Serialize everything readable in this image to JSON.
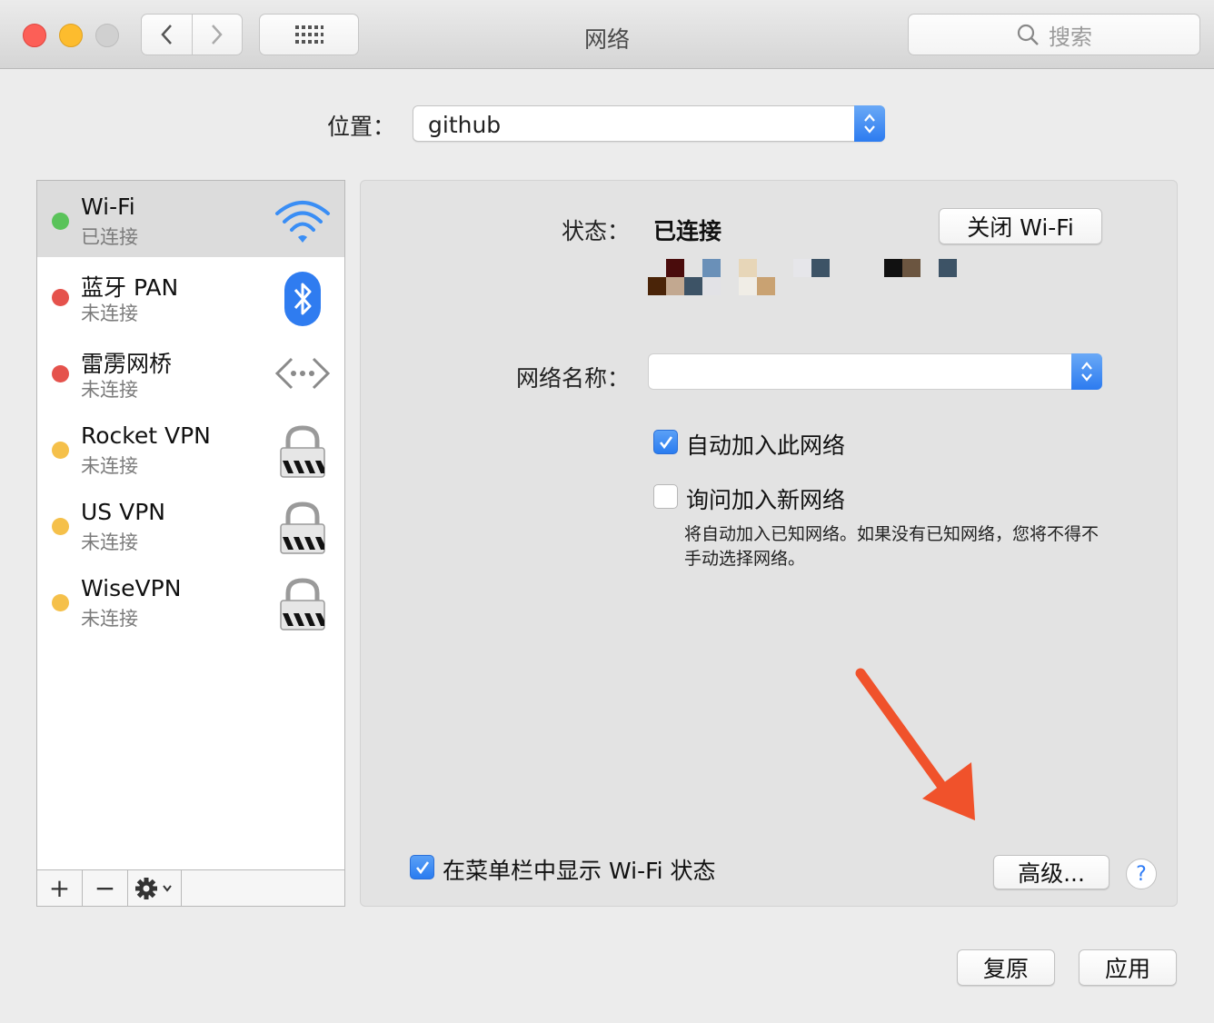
{
  "window": {
    "title": "网络",
    "search_placeholder": "搜索"
  },
  "location": {
    "label": "位置：",
    "value": "github"
  },
  "services": [
    {
      "name": "Wi-Fi",
      "status": "已连接",
      "dot_color": "#5ac35a",
      "icon": "wifi-icon",
      "selected": true
    },
    {
      "name": "蓝牙 PAN",
      "status": "未连接",
      "dot_color": "#e5524c",
      "icon": "bluetooth-icon"
    },
    {
      "name": "雷雳网桥",
      "status": "未连接",
      "dot_color": "#e5524c",
      "icon": "thunderbolt-bridge-icon"
    },
    {
      "name": "Rocket VPN",
      "status": "未连接",
      "dot_color": "#f5c04a",
      "icon": "vpn-lock-icon"
    },
    {
      "name": "US VPN",
      "status": "未连接",
      "dot_color": "#f5c04a",
      "icon": "vpn-lock-icon"
    },
    {
      "name": "WiseVPN",
      "status": "未连接",
      "dot_color": "#f5c04a",
      "icon": "vpn-lock-icon"
    }
  ],
  "sidebar_controls": {
    "add": "+",
    "remove": "−"
  },
  "detail": {
    "status_label": "状态：",
    "status_value": "已连接",
    "turn_off_button": "关闭 Wi-Fi",
    "network_name_label": "网络名称：",
    "network_name_value": "",
    "auto_join_label": "自动加入此网络",
    "auto_join_checked": true,
    "ask_join_label": "询问加入新网络",
    "ask_join_checked": false,
    "hint": "将自动加入已知网络。如果没有已知网络，您将不得不手动选择网络。",
    "show_in_menubar_label": "在菜单栏中显示 Wi-Fi 状态",
    "show_in_menubar_checked": true,
    "advanced_button": "高级...",
    "help": "?"
  },
  "footer": {
    "revert_button": "复原",
    "apply_button": "应用"
  },
  "colors": {
    "accent": "#2c7bf0",
    "annotation_arrow": "#f0522b"
  }
}
